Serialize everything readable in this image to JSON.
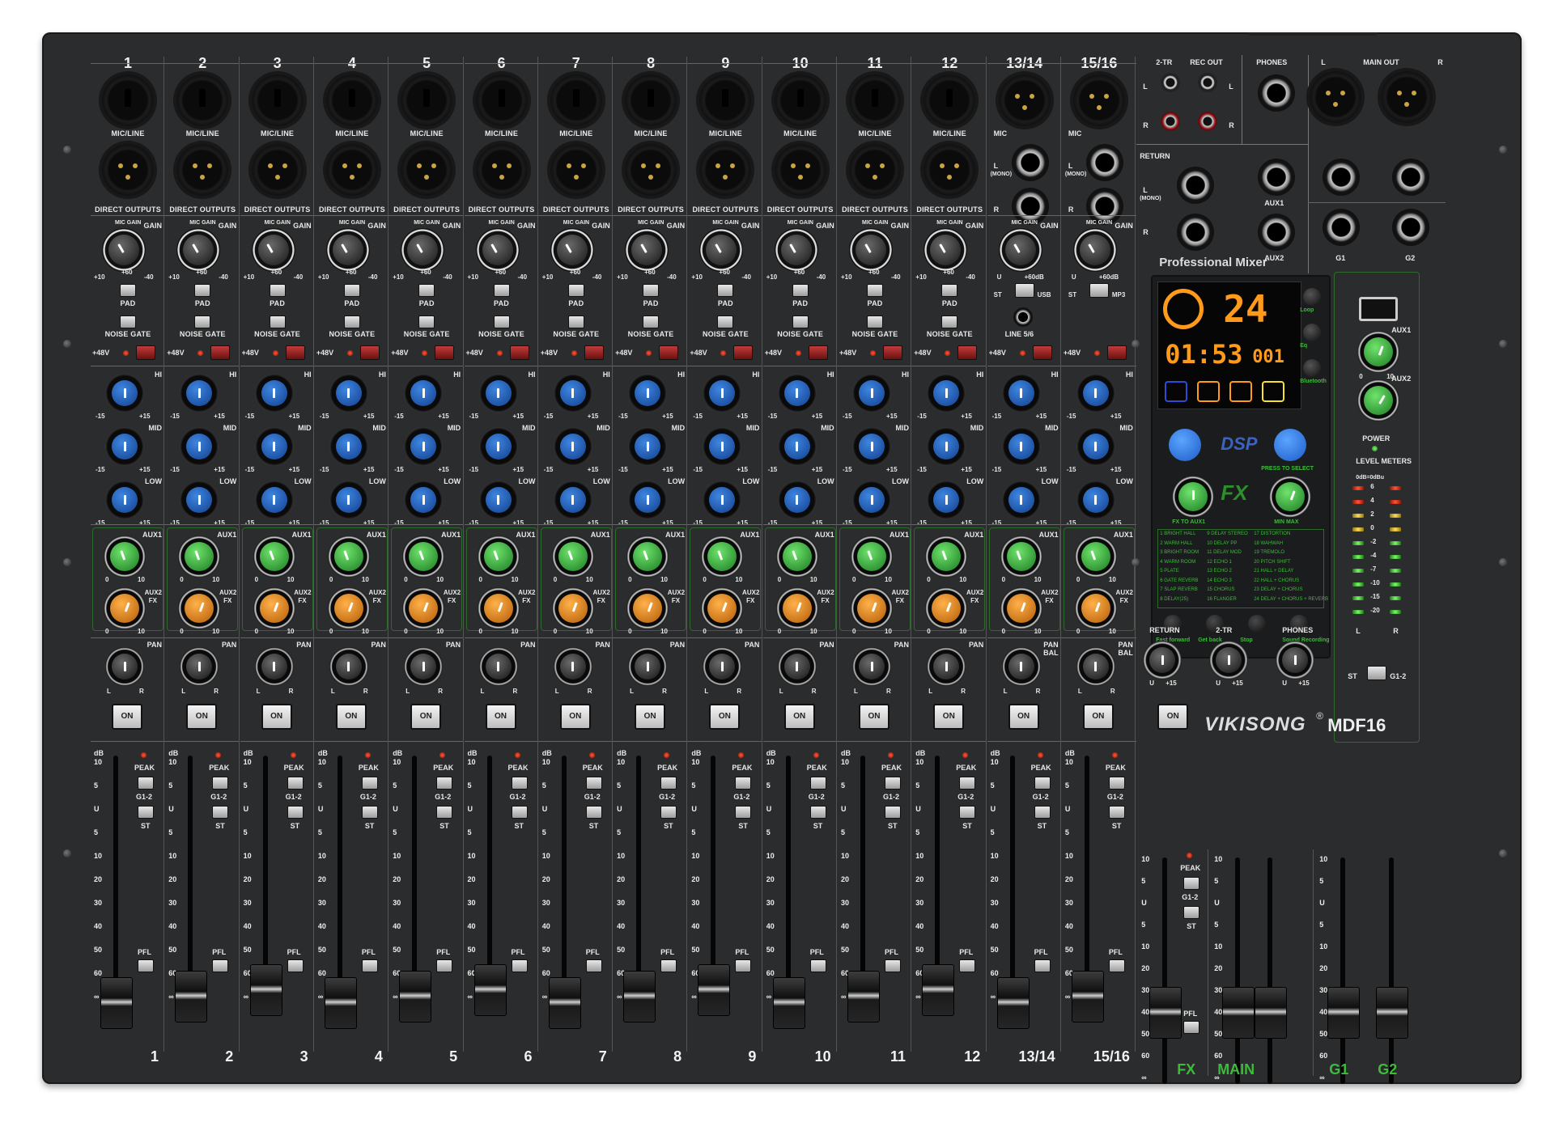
{
  "brand": {
    "name": "VIKISONG",
    "reg": "®",
    "model": "MDF16"
  },
  "channels": [
    {
      "num": "1",
      "bottom": "1",
      "type": "mono"
    },
    {
      "num": "2",
      "bottom": "2",
      "type": "mono"
    },
    {
      "num": "3",
      "bottom": "3",
      "type": "mono"
    },
    {
      "num": "4",
      "bottom": "4",
      "type": "mono"
    },
    {
      "num": "5",
      "bottom": "5",
      "type": "mono"
    },
    {
      "num": "6",
      "bottom": "6",
      "type": "mono"
    },
    {
      "num": "7",
      "bottom": "7",
      "type": "mono"
    },
    {
      "num": "8",
      "bottom": "8",
      "type": "mono"
    },
    {
      "num": "9",
      "bottom": "9",
      "type": "mono"
    },
    {
      "num": "10",
      "bottom": "10",
      "type": "mono"
    },
    {
      "num": "11",
      "bottom": "11",
      "type": "mono"
    },
    {
      "num": "12",
      "bottom": "12",
      "type": "mono"
    },
    {
      "num": "13/14",
      "bottom": "13/14",
      "type": "stereo"
    },
    {
      "num": "15/16",
      "bottom": "15/16",
      "type": "stereo"
    }
  ],
  "labels": {
    "mic_line": "MIC/LINE",
    "direct_outputs": "DIRECT OUTPUTS",
    "mic": "MIC",
    "l_mono_l": "L",
    "l_mono_mono": "(MONO)",
    "r": "R",
    "gain": "GAIN",
    "mic_gain": "MIC GAIN",
    "u": "U",
    "plus10": "+10",
    "plus60": "+60",
    "minus40": "-40",
    "plus60db": "+60dB",
    "pad": "PAD",
    "noise_gate": "NOISE GATE",
    "phantom": "+48V",
    "st": "ST",
    "usb": "USB",
    "mp3": "MP3",
    "line56": "LINE 5/6",
    "hi": "HI",
    "mid": "MID",
    "low": "LOW",
    "m15": "-15",
    "p15": "+15",
    "aux1": "AUX1",
    "aux2": "AUX2",
    "fx": "FX",
    "zero": "0",
    "ten": "10",
    "pan": "PAN",
    "bal": "BAL",
    "l": "L",
    "on": "ON",
    "db": "dB",
    "peak": "PEAK",
    "g12": "G1-2",
    "pfl": "PFL"
  },
  "fader_scale": [
    "10",
    "5",
    "U",
    "5",
    "10",
    "20",
    "30",
    "40",
    "50",
    "60",
    "∞"
  ],
  "io": {
    "two_tr": "2-TR",
    "rec_out": "REC OUT",
    "phones": "PHONES",
    "main_out": "MAIN OUT",
    "l": "L",
    "r": "R",
    "return": "RETURN",
    "mono_l": "L",
    "mono": "(MONO)",
    "aux1": "AUX1",
    "aux2": "AUX2",
    "g1": "G1",
    "g2": "G2"
  },
  "dsp": {
    "title": "Professional Mixer",
    "preset": "24",
    "time": "01:53",
    "track": "001",
    "side_buttons": [
      "Loop",
      "Eq",
      "Bluetooth"
    ],
    "dsp_label": "DSP",
    "fx_label": "FX",
    "press_to_select": "PRESS TO SELECT",
    "min_max": "MIN  MAX",
    "fx_to_aux1": "FX TO AUX1",
    "presets": [
      [
        "1 BRIGHT HALL",
        "9 DELAY STEREO",
        "17 DISTORTION"
      ],
      [
        "2 WARM HALL",
        "10 DELAY PP",
        "18 WAHWAH"
      ],
      [
        "3 BRIGHT ROOM",
        "11 DELAY MOD",
        "19 TREMOLO"
      ],
      [
        "4 WARM ROOM",
        "12 ECHO 1",
        "20 PITCH SHIFT"
      ],
      [
        "5 PLATE",
        "13 ECHO 2",
        "21 HALL + DELAY"
      ],
      [
        "6 GATE REVERB",
        "14 ECHO 3",
        "22 HALL + CHORUS"
      ],
      [
        "7 SLAP REVERB",
        "15 CHORUS",
        "23 DELAY + CHORUS"
      ],
      [
        "8 DELAY(25)",
        "16 FLANGER",
        "24 DELAY + CHORUS + REVERB"
      ]
    ],
    "transport": [
      "Fast forward",
      "Get back",
      "Stop",
      "Sound Recording"
    ]
  },
  "master": {
    "aux1": "AUX1",
    "aux2": "AUX2",
    "power": "POWER",
    "level_meters": "LEVEL METERS",
    "odb": "0dB=0dBu",
    "meter_scale": [
      "6",
      "4",
      "2",
      "0",
      "-2",
      "-4",
      "-7",
      "-10",
      "-15",
      "-20"
    ],
    "l": "L",
    "r": "R",
    "st": "ST",
    "g12": "G1-2",
    "zero": "0",
    "ten": "10",
    "return": "RETURN",
    "two_tr": "2-TR",
    "phones": "PHONES",
    "u": "U",
    "p15": "+15",
    "on": "ON"
  },
  "bottom_labels": {
    "fx": "FX",
    "main": "MAIN",
    "g1": "G1",
    "g2": "G2"
  },
  "colors": {
    "accent_green": "#3dbb3a",
    "knob_blue": "#2f6fd1",
    "knob_orange": "#f08c18",
    "knob_green": "#4fcf4a",
    "display_orange": "#ff9a1a",
    "display_yellow": "#f7e32b"
  }
}
